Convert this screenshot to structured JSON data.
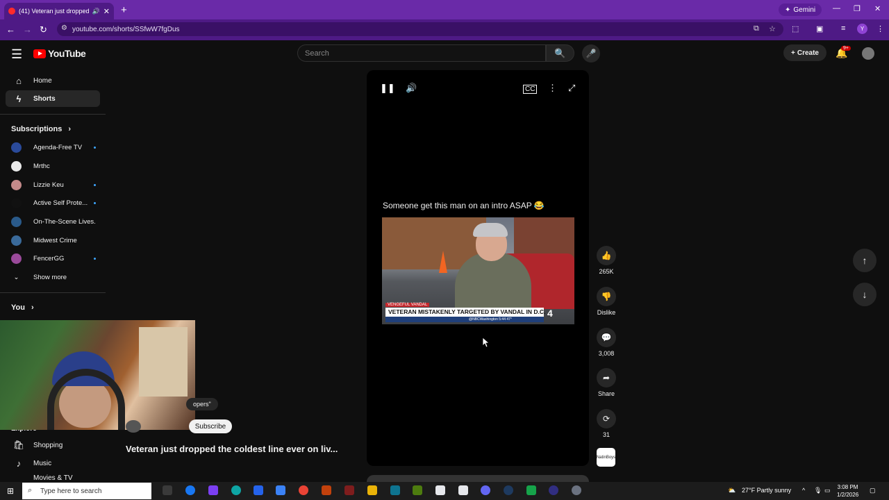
{
  "browser": {
    "tab_title": "(41) Veteran just dropped t",
    "new_tab": "+",
    "gemini": "Gemini",
    "url": "youtube.com/shorts/SSfwW7fgDus",
    "profile_letter": "Y",
    "window_controls": {
      "minimize": "—",
      "restore": "❐",
      "close": "✕"
    }
  },
  "youtube": {
    "logo": "YouTube",
    "search_placeholder": "Search",
    "create": "Create",
    "notif_count": "9+"
  },
  "sidebar": {
    "home": "Home",
    "shorts": "Shorts",
    "subscriptions": "Subscriptions",
    "subs": [
      {
        "name": "Agenda-Free TV",
        "dot": true,
        "color": "#2a4a9a"
      },
      {
        "name": "Mrthc",
        "dot": false,
        "color": "#e8e8e8"
      },
      {
        "name": "Lizzie Keu",
        "dot": true,
        "color": "#c48a8a"
      },
      {
        "name": "Active Self Prote...",
        "dot": true,
        "color": "#111111"
      },
      {
        "name": "On-The-Scene Lives...",
        "dot": false,
        "color": "#2a5a8a"
      },
      {
        "name": "Midwest Crime",
        "dot": false,
        "color": "#3a6a9a"
      },
      {
        "name": "FencerGG",
        "dot": true,
        "color": "#9a4a9a"
      }
    ],
    "show_more": "Show more",
    "you": "You",
    "explore": "Explore",
    "shopping": "Shopping",
    "music": "Music",
    "movies": "Movies & TV"
  },
  "short": {
    "caption": "Someone get this man on an intro ASAP 😂",
    "news_tag": "VENGEFUL VANDAL",
    "news_headline": "VETERAN MISTAKENLY TARGETED BY VANDAL IN D.C.",
    "news_sub": "@NBCWashington   5:44   47°",
    "station": "4",
    "title": "Veteran just dropped the coldest line ever on liv...",
    "chip": "opers\"",
    "subscribe": "Subscribe"
  },
  "actions": {
    "likes": "265K",
    "dislike": "Dislike",
    "comments": "3,008",
    "share": "Share",
    "remix": "31",
    "sound_label": "NatinBoys"
  },
  "taskbar": {
    "search": "Type here to search",
    "weather": "27°F  Partly sunny",
    "time": "3:08 PM",
    "date": "1/2/2026"
  }
}
